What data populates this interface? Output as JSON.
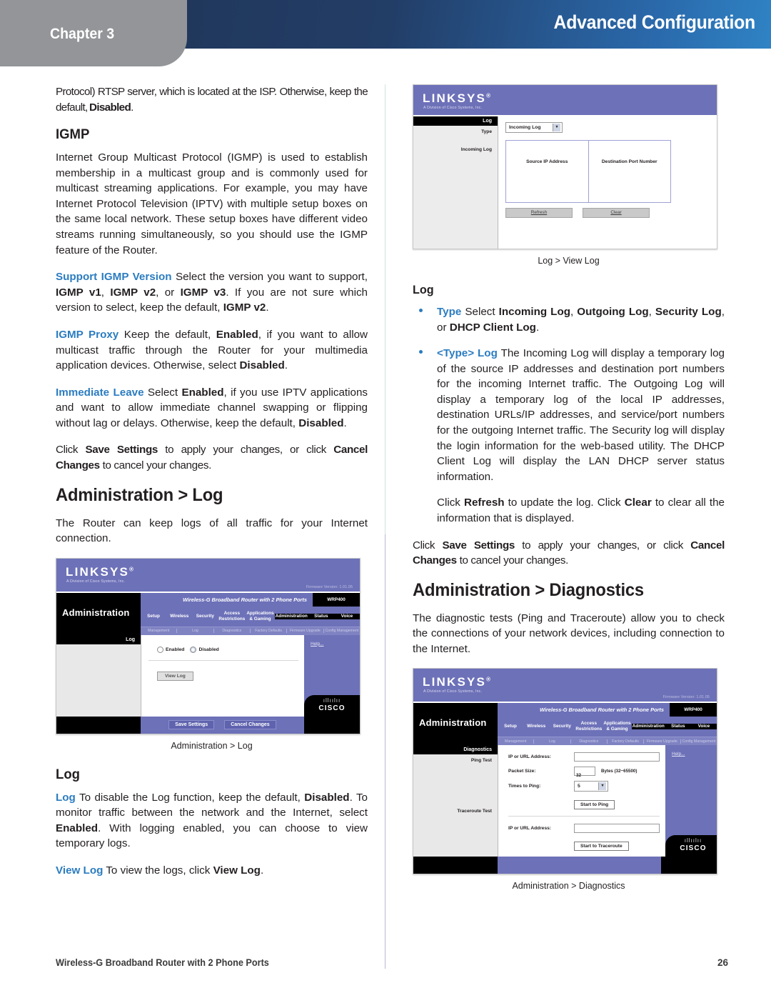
{
  "header": {
    "chapter": "Chapter  3",
    "title": "Advanced Configuration",
    "gradient_start": "#21385c",
    "gradient_end": "#2f83c4",
    "chapter_tab_color": "#939598"
  },
  "accent_color": "#2b7cc0",
  "left_column": {
    "intro_paragraph_prefix": "Protocol) RTSP server, which is located at the ISP. Otherwise, keep the default, ",
    "intro_paragraph_bold": "Disabled",
    "intro_paragraph_suffix": ".",
    "igmp_heading": "IGMP",
    "igmp_paragraph": "Internet Group Multicast Protocol (IGMP) is used to establish membership in a multicast group and is commonly used for multicast streaming applications. For example, you may have Internet Protocol Television (IPTV) with multiple setup boxes on the same local network. These setup boxes have different video streams running simultaneously, so you should use the IGMP feature of the Router.",
    "support_version": {
      "term": "Support IGMP Version",
      "t1": " Select the version you want to support, ",
      "b1": "IGMP  v1",
      "t2": ", ",
      "b2": "IGMP v2",
      "t3": ", or ",
      "b3": "IGMP v3",
      "t4": ". If you are not sure which version to select, keep the default, ",
      "b4": "IGMP v2",
      "t5": "."
    },
    "igmp_proxy": {
      "term": "IGMP Proxy",
      "t1": " Keep the default, ",
      "b1": "Enabled",
      "t2": ", if you want to allow multicast traffic through the Router for your multimedia application devices. Otherwise, select ",
      "b2": "Disabled",
      "t3": "."
    },
    "immediate_leave": {
      "term": "Immediate Leave",
      "t1": " Select ",
      "b1": "Enabled",
      "t2": ", if you use IPTV applications and want to allow immediate channel swapping or flipping without lag or delays. Otherwise, keep the default, ",
      "b2": "Disabled",
      "t3": "."
    },
    "save_cancel": {
      "t1": "Click ",
      "b1": "Save Settings",
      "t2": " to apply your changes, or click ",
      "b2": "Cancel Changes",
      "t3": " to cancel your changes."
    },
    "admin_log_heading": "Administration > Log",
    "admin_log_paragraph": "The Router can keep logs of all traffic for your Internet connection.",
    "figure_admin_log_caption": "Administration > Log",
    "log_heading": "Log",
    "log_item": {
      "term": "Log",
      "t1": " To disable the Log function, keep the default, ",
      "b1": "Disabled",
      "t2": ". To monitor traffic between the network and the Internet, select ",
      "b2": "Enabled",
      "t3": ". With logging enabled, you can choose to view temporary logs."
    },
    "view_log_item": {
      "term": "View Log",
      "t1": "  To view the logs, click ",
      "b1": "View Log",
      "t2": "."
    }
  },
  "right_column": {
    "figure_viewlog_caption": "Log > View Log",
    "log_heading": "Log",
    "bullet_type": {
      "term": "Type",
      "t1": "  Select ",
      "b1": "Incoming Log",
      "t2": ", ",
      "b2": "Outgoing Log",
      "t3": ", ",
      "b3": "Security Log",
      "t4": ", or ",
      "b4": "DHCP Client Log",
      "t5": "."
    },
    "bullet_typelog": {
      "term": "<Type> Log",
      "text": "  The Incoming Log will display a temporary log of the source IP addresses and destination port numbers for the incoming Internet traffic. The Outgoing Log will display a temporary log of the local IP addresses, destination URLs/IP addresses, and service/port numbers for the outgoing Internet traffic. The Security log will display the login information for the web-based utility. The DHCP Client Log will display the LAN DHCP server status information."
    },
    "refresh_clear": {
      "t1": "Click ",
      "b1": "Refresh",
      "t2": " to update the log. Click ",
      "b2": "Clear",
      "t3": " to clear all the information that is displayed."
    },
    "save_cancel": {
      "t1": "Click ",
      "b1": "Save Settings",
      "t2": " to apply your changes, or click ",
      "b2": "Cancel Changes",
      "t3": " to cancel your changes."
    },
    "diagnostics_heading": "Administration > Diagnostics",
    "diagnostics_paragraph": "The diagnostic tests (Ping and Traceroute) allow you to check the connections of your network devices, including connection to the Internet.",
    "figure_diagnostics_caption": "Administration > Diagnostics"
  },
  "router_ui": {
    "brand": "LINKSYS",
    "brand_reg": "®",
    "brand_sub": "A Division of Cisco Systems, Inc.",
    "firmware": "Firmware Version: 1.01.05",
    "product_name": "Wireless-G Broadband Router with 2 Phone Ports",
    "model": "WRP400",
    "tabs": [
      "Setup",
      "Wireless",
      "Security",
      "Access Restrictions",
      "Applications & Gaming",
      "Administration",
      "Status",
      "Voice"
    ],
    "subtabs": [
      "Management",
      "Log",
      "Diagnostics",
      "Factory Defaults",
      "Firmware Upgrade",
      "Config Management"
    ],
    "help_label": "Help...",
    "cisco_word": "CISCO",
    "cisco_bridge": "ıllıılıı",
    "save_settings": "Save Settings",
    "cancel_changes": "Cancel Changes"
  },
  "admin_log_screen": {
    "section_title": "Administration",
    "sidebar_head": "Log",
    "radio_enabled": "Enabled",
    "radio_disabled": "Disabled",
    "view_log_button": "View Log"
  },
  "view_log_screen": {
    "sidebar_head": "Log",
    "type_label": "Type",
    "type_value": "Incoming Log",
    "incoming_log_label": "Incoming Log",
    "col_source": "Source IP Address",
    "col_destination": "Destination Port Number",
    "refresh_button": "Refresh",
    "clear_button": "Clear"
  },
  "diagnostics_screen": {
    "section_title": "Administration",
    "sidebar_head": "Diagnostics",
    "ping_test_label": "Ping Test",
    "traceroute_test_label": "Traceroute Test",
    "ip_url_label": "IP or URL Address:",
    "packet_size_label": "Packet Size:",
    "packet_size_value": "32",
    "packet_size_unit": "Bytes (32~65500)",
    "times_to_ping_label": "Times to Ping:",
    "times_to_ping_value": "5",
    "start_ping_button": "Start to Ping",
    "start_traceroute_button": "Start to Traceroute"
  },
  "footer": {
    "document": "Wireless-G Broadband Router with 2 Phone Ports",
    "page_number": "26"
  }
}
